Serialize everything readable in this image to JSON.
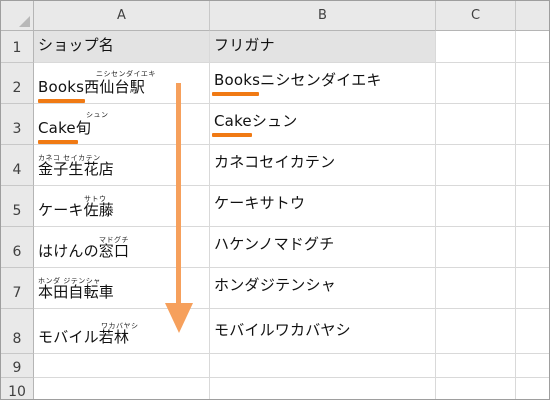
{
  "columns": [
    "A",
    "B",
    "C"
  ],
  "rows": [
    "1",
    "2",
    "3",
    "4",
    "5",
    "6",
    "7",
    "8",
    "9",
    "10"
  ],
  "headers": {
    "shop": "ショップ名",
    "furigana": "フリガナ"
  },
  "shops": [
    {
      "name": "Books西仙台駅",
      "ruby": "ニシセンダイエキ",
      "furigana": "Booksニシセンダイエキ"
    },
    {
      "name": "Cake旬",
      "ruby": "シュン",
      "furigana": "Cakeシュン"
    },
    {
      "name": "金子生花店",
      "ruby": "カネコ セイカテン",
      "furigana": "カネコセイカテン"
    },
    {
      "name": "ケーキ佐藤",
      "ruby": "サトウ",
      "furigana": "ケーキサトウ"
    },
    {
      "name": "はけんの窓口",
      "ruby": "マドグチ",
      "furigana": "ハケンノマドグチ"
    },
    {
      "name": "本田自転車",
      "ruby": "ホンダ ジテンシャ",
      "furigana": "ホンダジテンシャ"
    },
    {
      "name": "モバイル若林",
      "ruby": "ワカバヤシ",
      "furigana": "モバイルワカバヤシ"
    }
  ],
  "colors": {
    "accent": "#f07a14",
    "arrow": "#f6a05c"
  }
}
